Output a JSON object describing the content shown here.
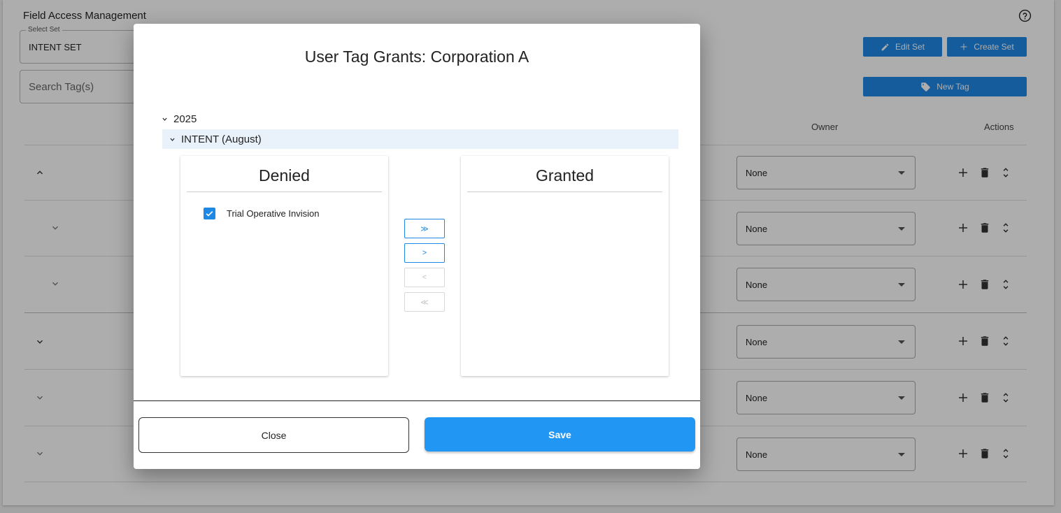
{
  "page": {
    "title": "Field Access Management",
    "select_set": {
      "label": "Select Set",
      "value": "INTENT SET"
    },
    "search": {
      "placeholder": "Search Tag(s)"
    },
    "edit_set_label": "Edit Set",
    "create_set_label": "Create Set",
    "new_tag_label": "New Tag",
    "columns": {
      "owner": "Owner",
      "actions": "Actions"
    },
    "rows": [
      {
        "owner": "None",
        "expanded": true
      },
      {
        "owner": "None",
        "expanded": false
      },
      {
        "owner": "None",
        "expanded": false
      },
      {
        "owner": "None",
        "expanded": false
      },
      {
        "owner": "None",
        "expanded": false
      },
      {
        "owner": "None",
        "expanded": false
      }
    ]
  },
  "modal": {
    "title": "User Tag Grants: Corporation A",
    "year": "2025",
    "group": "INTENT (August)",
    "denied": {
      "title": "Denied",
      "items": [
        {
          "label": "Trial Operative Invision",
          "checked": true
        }
      ]
    },
    "granted": {
      "title": "Granted",
      "items": []
    },
    "transfer": {
      "move_all_right": "≫",
      "move_right": ">",
      "move_left": "<",
      "move_all_left": "≪"
    },
    "close_label": "Close",
    "save_label": "Save"
  },
  "colors": {
    "accent": "#1e88e5",
    "save": "#2196f3",
    "highlight_row": "#e9f2fb"
  },
  "icons": [
    "help-circle-icon",
    "pencil-icon",
    "plus-icon",
    "tag-icon",
    "chevron-up-icon",
    "chevron-down-icon",
    "trash-icon",
    "unfold-icon",
    "check-icon"
  ]
}
